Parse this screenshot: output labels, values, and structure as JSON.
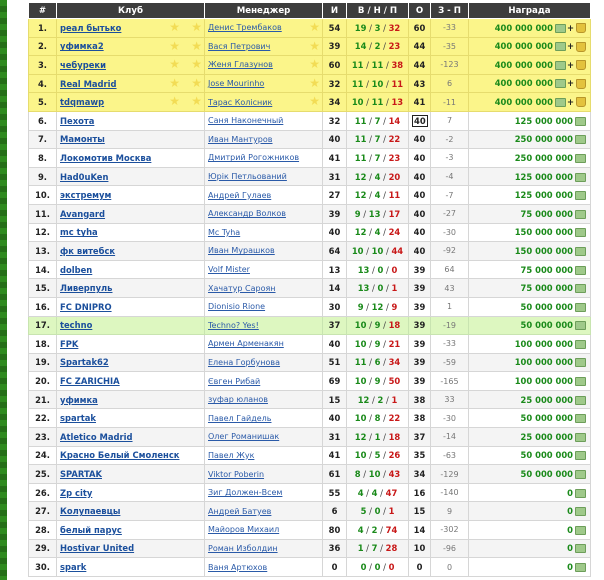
{
  "headers": {
    "rank": "#",
    "club": "Клуб",
    "manager": "Менеджер",
    "games": "И",
    "wdl": "В / Н / П",
    "points": "О",
    "diff": "З - П",
    "prize": "Награда"
  },
  "rows": [
    {
      "rank": "1.",
      "club": "реал бытько",
      "manager": "Денис Трембаков",
      "games": "54",
      "w": "19",
      "d": "3",
      "l": "32",
      "points": "60",
      "diff": "-33",
      "prize": "400 000 000",
      "plus": "+",
      "style": "top"
    },
    {
      "rank": "2.",
      "club": "уфимка2",
      "manager": "Вася Петрович",
      "games": "39",
      "w": "14",
      "d": "2",
      "l": "23",
      "points": "44",
      "diff": "-35",
      "prize": "400 000 000",
      "plus": "+",
      "style": "top"
    },
    {
      "rank": "3.",
      "club": "чебуреки",
      "manager": "Женя Глазунов",
      "games": "60",
      "w": "11",
      "d": "11",
      "l": "38",
      "points": "44",
      "diff": "-123",
      "prize": "400 000 000",
      "plus": "+",
      "style": "top"
    },
    {
      "rank": "4.",
      "club": "Real Madrid",
      "manager": "Jose Mourinho",
      "games": "32",
      "w": "11",
      "d": "10",
      "l": "11",
      "points": "43",
      "diff": "6",
      "prize": "400 000 000",
      "plus": "+",
      "style": "top"
    },
    {
      "rank": "5.",
      "club": "tdqmawp",
      "manager": "Тарас Колісник",
      "games": "34",
      "w": "10",
      "d": "11",
      "l": "13",
      "points": "41",
      "diff": "-11",
      "prize": "400 000 000",
      "plus": "+",
      "style": "top"
    },
    {
      "rank": "6.",
      "club": "Пехота",
      "manager": "Саня Наконечный",
      "games": "32",
      "w": "11",
      "d": "7",
      "l": "14",
      "points": "40",
      "diff": "7",
      "prize": "125 000 000",
      "plus": "",
      "style": "odd",
      "box": true
    },
    {
      "rank": "7.",
      "club": "Мамонты",
      "manager": "Иван Мантуров",
      "games": "40",
      "w": "11",
      "d": "7",
      "l": "22",
      "points": "40",
      "diff": "-2",
      "prize": "250 000 000",
      "plus": "",
      "style": "even"
    },
    {
      "rank": "8.",
      "club": "Локомотив Москва",
      "manager": "Дмитрий Рогожников",
      "games": "41",
      "w": "11",
      "d": "7",
      "l": "23",
      "points": "40",
      "diff": "-3",
      "prize": "250 000 000",
      "plus": "",
      "style": "odd"
    },
    {
      "rank": "9.",
      "club": "Had0uKen",
      "manager": "Юрік Петльований",
      "games": "31",
      "w": "12",
      "d": "4",
      "l": "20",
      "points": "40",
      "diff": "-4",
      "prize": "125 000 000",
      "plus": "",
      "style": "even"
    },
    {
      "rank": "10.",
      "club": "экстремум",
      "manager": "Андрей Гулаев",
      "games": "27",
      "w": "12",
      "d": "4",
      "l": "11",
      "points": "40",
      "diff": "-7",
      "prize": "125 000 000",
      "plus": "",
      "style": "odd"
    },
    {
      "rank": "11.",
      "club": "Avangard",
      "manager": "Александр Волков",
      "games": "39",
      "w": "9",
      "d": "13",
      "l": "17",
      "points": "40",
      "diff": "-27",
      "prize": "75 000 000",
      "plus": "",
      "style": "even"
    },
    {
      "rank": "12.",
      "club": "mc tyha",
      "manager": "Mc Tyha",
      "games": "40",
      "w": "12",
      "d": "4",
      "l": "24",
      "points": "40",
      "diff": "-30",
      "prize": "150 000 000",
      "plus": "",
      "style": "odd"
    },
    {
      "rank": "13.",
      "club": "фк витебск",
      "manager": "Иван Мурашков",
      "games": "64",
      "w": "10",
      "d": "10",
      "l": "44",
      "points": "40",
      "diff": "-92",
      "prize": "150 000 000",
      "plus": "",
      "style": "even"
    },
    {
      "rank": "14.",
      "club": "dolben",
      "manager": "Volf Mister",
      "games": "13",
      "w": "13",
      "d": "0",
      "l": "0",
      "points": "39",
      "diff": "64",
      "prize": "75 000 000",
      "plus": "",
      "style": "odd"
    },
    {
      "rank": "15.",
      "club": "Ливерпуль",
      "manager": "Хачатур Сароян",
      "games": "14",
      "w": "13",
      "d": "0",
      "l": "1",
      "points": "39",
      "diff": "43",
      "prize": "75 000 000",
      "plus": "",
      "style": "even"
    },
    {
      "rank": "16.",
      "club": "FC DNIPRO",
      "manager": "Dionisio Rione",
      "games": "30",
      "w": "9",
      "d": "12",
      "l": "9",
      "points": "39",
      "diff": "1",
      "prize": "50 000 000",
      "plus": "",
      "style": "odd"
    },
    {
      "rank": "17.",
      "club": "techno",
      "manager": "Techno? Yes!",
      "games": "37",
      "w": "10",
      "d": "9",
      "l": "18",
      "points": "39",
      "diff": "-19",
      "prize": "50 000 000",
      "plus": "",
      "style": "hl"
    },
    {
      "rank": "18.",
      "club": "FPK",
      "manager": "Армен Арменакян",
      "games": "40",
      "w": "10",
      "d": "9",
      "l": "21",
      "points": "39",
      "diff": "-33",
      "prize": "100 000 000",
      "plus": "",
      "style": "odd"
    },
    {
      "rank": "19.",
      "club": "Spartak62",
      "manager": "Елена Горбунова",
      "games": "51",
      "w": "11",
      "d": "6",
      "l": "34",
      "points": "39",
      "diff": "-59",
      "prize": "100 000 000",
      "plus": "",
      "style": "even"
    },
    {
      "rank": "20.",
      "club": "FC ZARICHIA",
      "manager": "Євген Рибай",
      "games": "69",
      "w": "10",
      "d": "9",
      "l": "50",
      "points": "39",
      "diff": "-165",
      "prize": "100 000 000",
      "plus": "",
      "style": "odd"
    },
    {
      "rank": "21.",
      "club": "уфимка",
      "manager": "зуфар юланов",
      "games": "15",
      "w": "12",
      "d": "2",
      "l": "1",
      "points": "38",
      "diff": "33",
      "prize": "25 000 000",
      "plus": "",
      "style": "even"
    },
    {
      "rank": "22.",
      "club": "spartak",
      "manager": "Павел Гайдель",
      "games": "40",
      "w": "10",
      "d": "8",
      "l": "22",
      "points": "38",
      "diff": "-30",
      "prize": "50 000 000",
      "plus": "",
      "style": "odd"
    },
    {
      "rank": "23.",
      "club": "Atletico Madrid",
      "manager": "Олег Романишак",
      "games": "31",
      "w": "12",
      "d": "1",
      "l": "18",
      "points": "37",
      "diff": "-14",
      "prize": "25 000 000",
      "plus": "",
      "style": "even"
    },
    {
      "rank": "24.",
      "club": "Красно Белый Смоленск",
      "manager": "Павел Жук",
      "games": "41",
      "w": "10",
      "d": "5",
      "l": "26",
      "points": "35",
      "diff": "-63",
      "prize": "50 000 000",
      "plus": "",
      "style": "odd"
    },
    {
      "rank": "25.",
      "club": "SPARTAK",
      "manager": "Viktor Poberin",
      "games": "61",
      "w": "8",
      "d": "10",
      "l": "43",
      "points": "34",
      "diff": "-129",
      "prize": "50 000 000",
      "plus": "",
      "style": "even"
    },
    {
      "rank": "26.",
      "club": "Zp city",
      "manager": "Зиг Должен-Всем",
      "games": "55",
      "w": "4",
      "d": "4",
      "l": "47",
      "points": "16",
      "diff": "-140",
      "prize": "0",
      "plus": "",
      "style": "odd"
    },
    {
      "rank": "27.",
      "club": "Колупаевцы",
      "manager": "Андрей Батуев",
      "games": "6",
      "w": "5",
      "d": "0",
      "l": "1",
      "points": "15",
      "diff": "9",
      "prize": "0",
      "plus": "",
      "style": "even"
    },
    {
      "rank": "28.",
      "club": "белый парус",
      "manager": "Майоров Михаил",
      "games": "80",
      "w": "4",
      "d": "2",
      "l": "74",
      "points": "14",
      "diff": "-302",
      "prize": "0",
      "plus": "",
      "style": "odd"
    },
    {
      "rank": "29.",
      "club": "Hostivar United",
      "manager": "Роман Изболдин",
      "games": "36",
      "w": "1",
      "d": "7",
      "l": "28",
      "points": "10",
      "diff": "-96",
      "prize": "0",
      "plus": "",
      "style": "even"
    },
    {
      "rank": "30.",
      "club": "spark",
      "manager": "Ваня Артюхов",
      "games": "0",
      "w": "0",
      "d": "0",
      "l": "0",
      "points": "0",
      "diff": "0",
      "prize": "0",
      "plus": "",
      "style": "odd"
    }
  ],
  "colors": {
    "header_bg": "#3d3d3d",
    "top_row": "#fbf58a",
    "highlight_row": "#ddf7c0",
    "club_link": "#1b4f9c",
    "win": "#1a8a1a",
    "loss": "#c81818",
    "prize": "#1a8a1a"
  },
  "icons": {
    "money": "money-icon",
    "trophy": "trophy-icon",
    "star": "star-icon"
  }
}
